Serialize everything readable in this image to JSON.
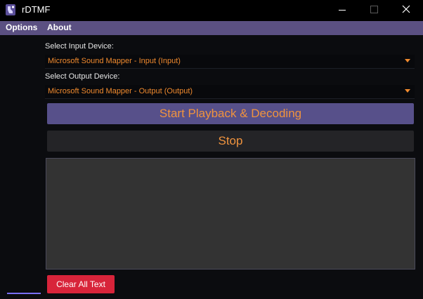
{
  "window": {
    "title": "rDTMF",
    "icon": "rdtmf-app-icon",
    "controls": [
      "minimize-icon",
      "maximize-icon",
      "close-icon"
    ]
  },
  "menu": {
    "items": [
      {
        "label": "Options"
      },
      {
        "label": "About"
      }
    ]
  },
  "input_device": {
    "label": "Select Input Device:",
    "selected": "Microsoft Sound Mapper - Input (Input)"
  },
  "output_device": {
    "label": "Select Output Device:",
    "selected": "Microsoft Sound Mapper - Output (Output)"
  },
  "buttons": {
    "start": "Start Playback & Decoding",
    "stop": "Stop",
    "clear": "Clear All Text"
  },
  "output_text": "",
  "colors": {
    "accent_purple": "#5b5082",
    "button_text_orange": "#f0933e",
    "combo_text_orange": "#f08a2e",
    "clear_button_red": "#d8243a",
    "background": "#0b0c0f"
  }
}
